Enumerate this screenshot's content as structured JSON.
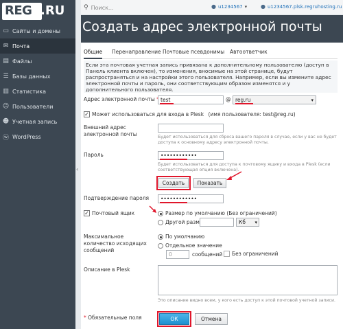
{
  "logo": {
    "part1": "REG",
    "part2": ".RU"
  },
  "sidebar": {
    "items": [
      {
        "label": "Сайты и домены",
        "icon": "monitor-icon"
      },
      {
        "label": "Почта",
        "icon": "mail-icon"
      },
      {
        "label": "Файлы",
        "icon": "folder-icon"
      },
      {
        "label": "Базы данных",
        "icon": "database-icon"
      },
      {
        "label": "Статистика",
        "icon": "chart-icon"
      },
      {
        "label": "Пользователи",
        "icon": "users-icon"
      },
      {
        "label": "Учетная запись",
        "icon": "account-icon"
      },
      {
        "label": "WordPress",
        "icon": "wordpress-icon"
      }
    ],
    "active_index": 1
  },
  "topbar": {
    "search_placeholder": "Поиск...",
    "user": "u1234567",
    "domain": "u1234567.plsk.regruhosting.ru"
  },
  "page_title": "Создать адрес электронной почты",
  "tabs": [
    "Общие",
    "Перенаправление",
    "Почтовые псевдонимы",
    "Автоответчик"
  ],
  "info_text": "Если эта почтовая учетная запись привязана к дополнительному пользователю (доступ в Панель клиента включен), то изменения, вносимые на этой странице, будут распространяться и на настройки этого пользователя. Например, если вы измените адрес электронной почты и пароль, они соответствующим образом изменятся и у дополнительного пользователя.",
  "form": {
    "email_label": "Адрес электронной почты",
    "required_mark": "*",
    "email_value": "test",
    "at_sign": "@",
    "domain_value": "reg.ru",
    "plesk_login_label": "Может использоваться для входа в Plesk",
    "plesk_login_user": "(имя пользователя: test@reg.ru)",
    "external_email_label": "Внешний адрес электронной почты",
    "external_email_note": "Будет использоваться для сброса вашего пароля в случае, если у вас не будет доступа к основному адресу электронной почты.",
    "password_label": "Пароль",
    "password_value": "••••••••••••",
    "password_note": "Будет использоваться для доступа к почтовому ящику и входа в Plesk (если соответствующая опция включена).",
    "generate_button": "Создать",
    "show_button": "Показать",
    "confirm_label": "Подтверждение пароля",
    "confirm_value": "••••••••••••",
    "mailbox_label": "Почтовый ящик",
    "mailbox_default": "Размер по умолчанию (Без ограничений)",
    "mailbox_other": "Другой размер",
    "size_unit": "Кб",
    "max_messages_label": "Максимальное количество исходящих сообщений",
    "max_default": "По умолчанию",
    "max_custom": "Отдельное значение",
    "max_value": "0",
    "messages_unit": "сообщений",
    "unlimited": "Без ограничений",
    "description_label": "Описание в Plesk",
    "description_note": "Это описание видно всем, у кого есть доступ к этой почтовой учетной записи.",
    "required_fields": "Обязательные поля",
    "ok_button": "ОК",
    "cancel_button": "Отмена"
  },
  "colors": {
    "sidebar": "#3c4752",
    "highlight": "#e0162b",
    "link": "#1d6fb8"
  }
}
